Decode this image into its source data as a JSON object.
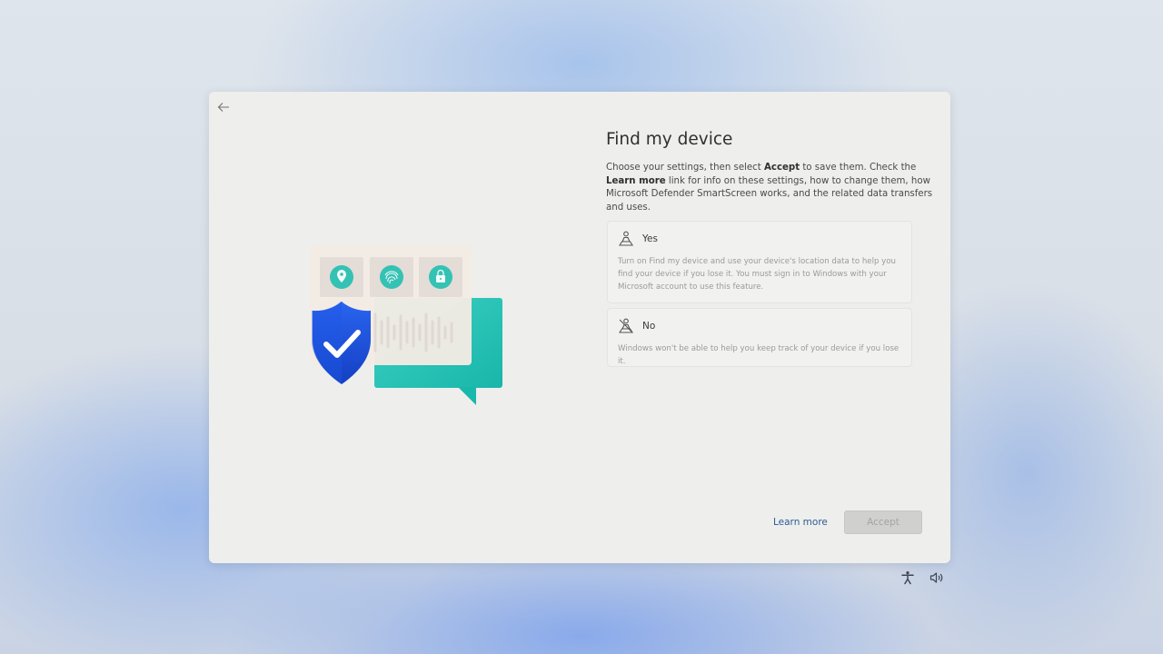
{
  "page": {
    "title": "Find my device",
    "description": {
      "part1": "Choose your settings, then select ",
      "bold1": "Accept",
      "part2": " to save them. Check the ",
      "bold2": "Learn more",
      "part3": " link for info on these settings, how to change them, how Microsoft Defender SmartScreen works, and the related data transfers and uses."
    }
  },
  "options": [
    {
      "label": "Yes",
      "text": "Turn on Find my device and use your device's location data to help you find your device if you lose it. You must sign in to Windows with your Microsoft account to use this feature.",
      "icon": "person-location-icon"
    },
    {
      "label": "No",
      "text": "Windows won't be able to help you keep track of your device if you lose it.",
      "icon": "person-location-off-icon"
    }
  ],
  "actions": {
    "learn_more": "Learn more",
    "accept": "Accept"
  },
  "nav": {
    "back_icon": "back-arrow-icon"
  },
  "tray": {
    "accessibility_icon": "accessibility-icon",
    "volume_icon": "volume-icon"
  },
  "colors": {
    "shield": "#1a4fd6",
    "teal": "#2fc7b8",
    "link": "#2a5c97",
    "window_bg": "#eeeeec"
  }
}
